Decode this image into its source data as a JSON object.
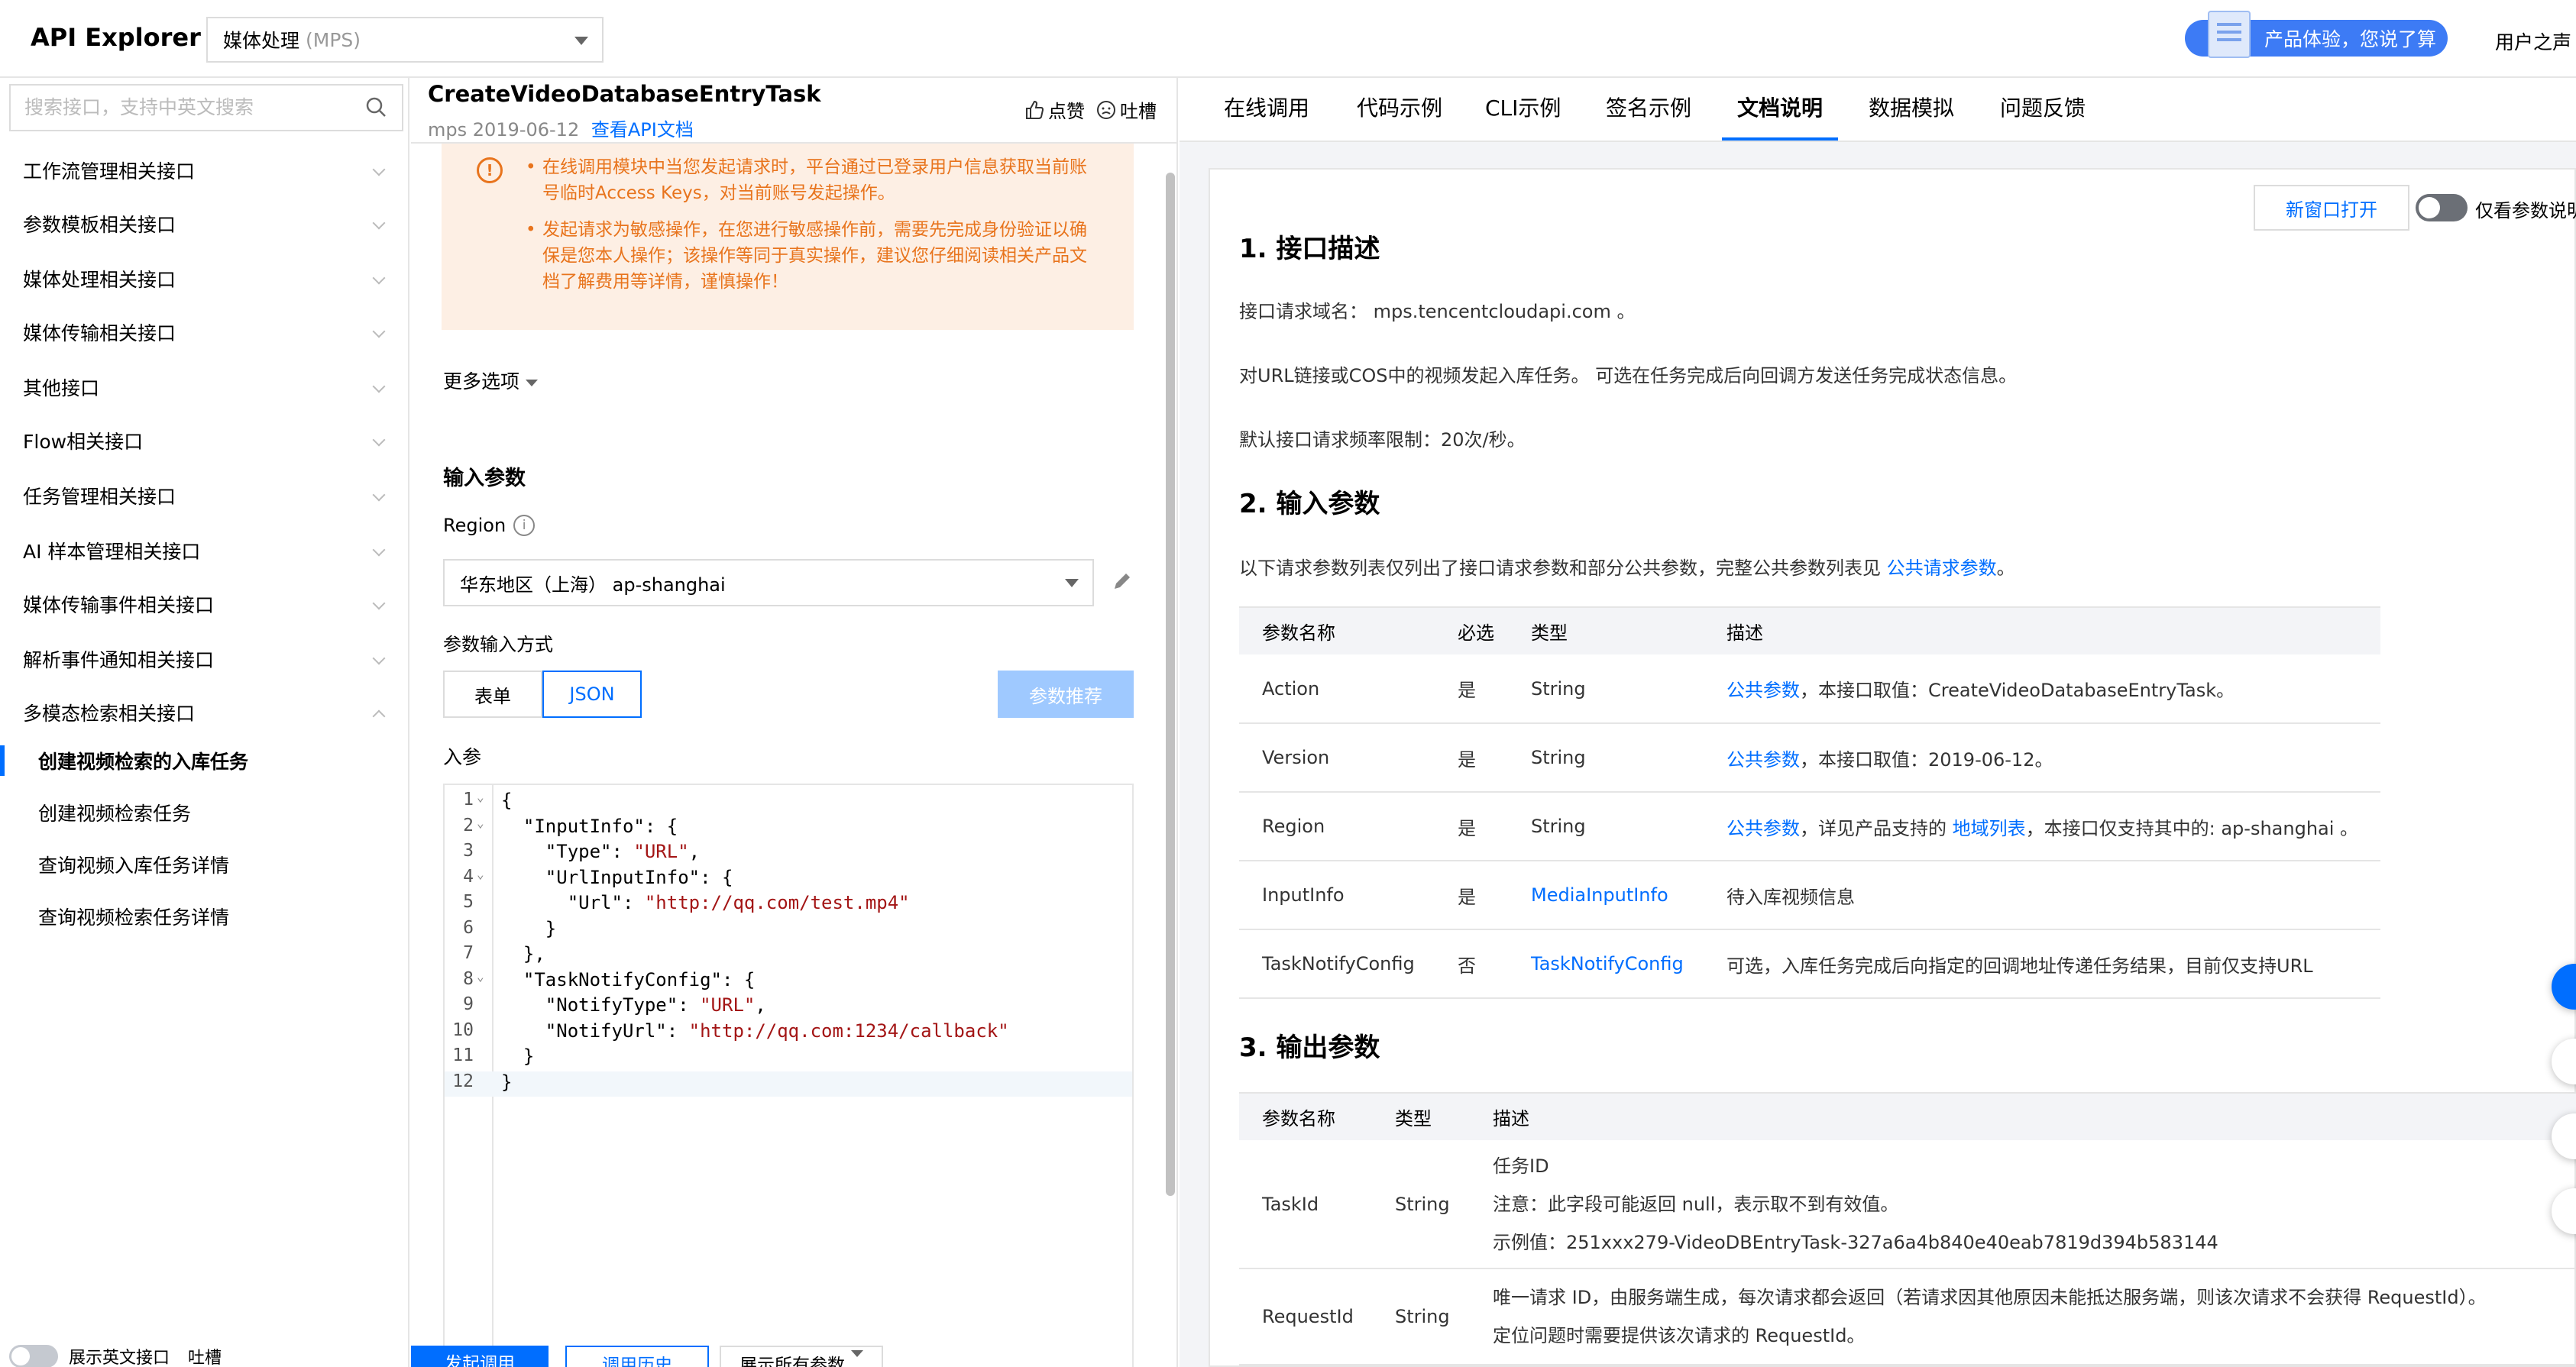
{
  "header": {
    "app_title": "API Explorer",
    "service_name": "媒体处理",
    "service_code": "(MPS)",
    "promo_text": "产品体验，您说了算",
    "user_center": "用户之声"
  },
  "sidebar": {
    "search_placeholder": "搜索接口，支持中英文搜索",
    "groups": [
      {
        "label": "工作流管理相关接口"
      },
      {
        "label": "参数模板相关接口"
      },
      {
        "label": "媒体处理相关接口"
      },
      {
        "label": "媒体传输相关接口"
      },
      {
        "label": "其他接口"
      },
      {
        "label": "Flow相关接口"
      },
      {
        "label": "任务管理相关接口"
      },
      {
        "label": "AI 样本管理相关接口"
      },
      {
        "label": "媒体传输事件相关接口"
      },
      {
        "label": "解析事件通知相关接口"
      },
      {
        "label": "多模态检索相关接口"
      }
    ],
    "sub_items": [
      {
        "label": "创建视频检索的入库任务",
        "active": true
      },
      {
        "label": "创建视频检索任务",
        "active": false
      },
      {
        "label": "查询视频入库任务详情",
        "active": false
      },
      {
        "label": "查询视频检索任务详情",
        "active": false
      }
    ],
    "footer_toggle_label": "展示英文接口",
    "footer_roast": "吐槽"
  },
  "middle": {
    "api_name": "CreateVideoDatabaseEntryTask",
    "api_meta": "mps 2019-06-12",
    "view_doc_link": "查看API文档",
    "like_label": "点赞",
    "roast_label": "吐槽",
    "alerts": [
      "在线调用模块中当您发起请求时，平台通过已登录用户信息获取当前账号临时Access Keys，对当前账号发起操作。",
      "发起请求为敏感操作，在您进行敏感操作前，需要先完成身份验证以确保是您本人操作；该操作等同于真实操作，建议您仔细阅读相关产品文档了解费用等详情，谨慎操作！"
    ],
    "more_options": "更多选项",
    "input_params_title": "输入参数",
    "region_label": "Region",
    "region_value": "华东地区（上海） ap-shanghai",
    "input_mode_label": "参数输入方式",
    "mode_form": "表单",
    "mode_json": "JSON",
    "recommend_button": "参数推荐",
    "params_label": "入参",
    "code_lines": [
      {
        "n": "1",
        "fold": "⌄",
        "parts": [
          [
            "{",
            ""
          ]
        ]
      },
      {
        "n": "2",
        "fold": "⌄",
        "parts": [
          [
            "  \"InputInfo\": {",
            ""
          ]
        ]
      },
      {
        "n": "3",
        "fold": "",
        "parts": [
          [
            "    \"Type\": ",
            ""
          ],
          [
            "\"URL\"",
            "str"
          ],
          [
            ",",
            ""
          ]
        ]
      },
      {
        "n": "4",
        "fold": "⌄",
        "parts": [
          [
            "    \"UrlInputInfo\": {",
            ""
          ]
        ]
      },
      {
        "n": "5",
        "fold": "",
        "parts": [
          [
            "      \"Url\": ",
            ""
          ],
          [
            "\"http://qq.com/test.mp4\"",
            "str"
          ]
        ]
      },
      {
        "n": "6",
        "fold": "",
        "parts": [
          [
            "    }",
            ""
          ]
        ]
      },
      {
        "n": "7",
        "fold": "",
        "parts": [
          [
            "  },",
            ""
          ]
        ]
      },
      {
        "n": "8",
        "fold": "⌄",
        "parts": [
          [
            "  \"TaskNotifyConfig\": {",
            ""
          ]
        ]
      },
      {
        "n": "9",
        "fold": "",
        "parts": [
          [
            "    \"NotifyType\": ",
            ""
          ],
          [
            "\"URL\"",
            "str"
          ],
          [
            ",",
            ""
          ]
        ]
      },
      {
        "n": "10",
        "fold": "",
        "parts": [
          [
            "    \"NotifyUrl\": ",
            ""
          ],
          [
            "\"http://qq.com:1234/callback\"",
            "str"
          ]
        ]
      },
      {
        "n": "11",
        "fold": "",
        "parts": [
          [
            "  }",
            ""
          ]
        ]
      },
      {
        "n": "12",
        "fold": "",
        "parts": [
          [
            "}",
            ""
          ]
        ]
      }
    ],
    "send_button": "发起调用",
    "history_button": "调用历史",
    "show_all_button": "展示所有参数"
  },
  "right": {
    "tabs": [
      "在线调用",
      "代码示例",
      "CLI示例",
      "签名示例",
      "文档说明",
      "数据模拟",
      "问题反馈"
    ],
    "active_tab": "文档说明",
    "new_window_button": "新窗口打开",
    "only_params_label": "仅看参数说明",
    "sec1_title": "1. 接口描述",
    "domain_text": "接口请求域名： mps.tencentcloudapi.com 。",
    "desc_text": "对URL链接或COS中的视频发起入库任务。 可选在任务完成后向回调方发送任务完成状态信息。",
    "freq_text": "默认接口请求频率限制：20次/秒。",
    "sec2_title": "2. 输入参数",
    "input_intro": "以下请求参数列表仅列出了接口请求参数和部分公共参数，完整公共参数列表见",
    "input_intro_link": "公共请求参数",
    "input_intro_end": "。",
    "input_headers": [
      "参数名称",
      "必选",
      "类型",
      "描述"
    ],
    "input_rows": [
      {
        "name": "Action",
        "req": "是",
        "type": "String",
        "type_link": false,
        "desc_link": "公共参数",
        "desc": "，本接口取值：CreateVideoDatabaseEntryTask。",
        "desc_link2": "",
        "desc_end": ""
      },
      {
        "name": "Version",
        "req": "是",
        "type": "String",
        "type_link": false,
        "desc_link": "公共参数",
        "desc": "，本接口取值：2019-06-12。",
        "desc_link2": "",
        "desc_end": ""
      },
      {
        "name": "Region",
        "req": "是",
        "type": "String",
        "type_link": false,
        "desc_link": "公共参数",
        "desc": "，详见产品支持的 ",
        "desc_link2": "地域列表",
        "desc_end": "，本接口仅支持其中的: ap-shanghai 。"
      },
      {
        "name": "InputInfo",
        "req": "是",
        "type": "MediaInputInfo",
        "type_link": true,
        "desc_link": "",
        "desc": "待入库视频信息",
        "desc_link2": "",
        "desc_end": ""
      },
      {
        "name": "TaskNotifyConfig",
        "req": "否",
        "type": "TaskNotifyConfig",
        "type_link": true,
        "desc_link": "",
        "desc": "可选，入库任务完成后向指定的回调地址传递任务结果，目前仅支持URL",
        "desc_link2": "",
        "desc_end": ""
      }
    ],
    "sec3_title": "3. 输出参数",
    "output_headers": [
      "参数名称",
      "类型",
      "描述"
    ],
    "output_rows": [
      {
        "name": "TaskId",
        "type": "String",
        "lines": [
          "任务ID",
          "注意：此字段可能返回 null，表示取不到有效值。",
          "示例值：251xxx279-VideoDBEntryTask-327a6a4b840e40eab7819d394b583144"
        ]
      },
      {
        "name": "RequestId",
        "type": "String",
        "lines": [
          "唯一请求 ID，由服务端生成，每次请求都会返回（若请求因其他原因未能抵达服务端，则该次请求不会获得 RequestId）。",
          "定位问题时需要提供该次请求的 RequestId。"
        ]
      }
    ]
  }
}
